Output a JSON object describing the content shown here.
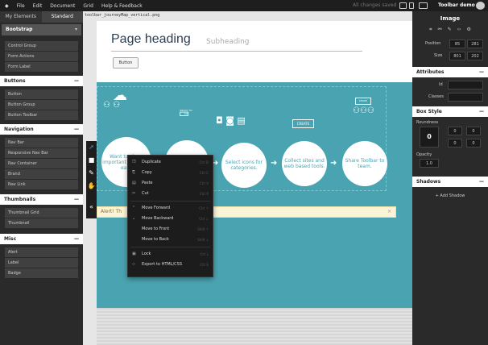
{
  "menu": {
    "items": [
      "File",
      "Edit",
      "Document",
      "Grid",
      "Help & Feedback"
    ],
    "status": "All changes saved",
    "app_name": "Toolbar demo"
  },
  "left_panel": {
    "tabs": [
      "My Elements",
      "Standard"
    ],
    "framework": "Bootstrap",
    "top_items": [
      "Control Group",
      "Form Actions",
      "Form Label"
    ],
    "sections": [
      {
        "title": "Buttons",
        "items": [
          "Button",
          "Button Group",
          "Button Toolbar"
        ]
      },
      {
        "title": "Navigation",
        "items": [
          "Nav Bar",
          "Responsive Nav Bar",
          "Nav Container",
          "Brand",
          "Nav Link"
        ]
      },
      {
        "title": "Thumbnails",
        "items": [
          "Thumbnail Grid",
          "Thumbnail"
        ]
      },
      {
        "title": "Misc",
        "items": [
          "Alert",
          "Label",
          "Badge"
        ]
      }
    ]
  },
  "canvas": {
    "file_name": "toolbar_journeyMap_vertical.png",
    "heading": "Page heading",
    "subheading": "Subheading",
    "button_label": "Button",
    "alert_text": "Alert! Th",
    "alert_close": "×",
    "journey": [
      "Want to share important with your easy",
      "",
      "Select icons for categories.",
      "Collect sites and web based tools.",
      "Share Toolbar to team."
    ],
    "badges": [
      "READY TO GO",
      "CREATE",
      "SHARE"
    ]
  },
  "context_menu": {
    "items": [
      {
        "icon": "duplicate-icon",
        "label": "Duplicate",
        "shortcut": "Ctrl D"
      },
      {
        "icon": "copy-icon",
        "label": "Copy",
        "shortcut": "Ctrl C"
      },
      {
        "icon": "paste-icon",
        "label": "Paste",
        "shortcut": "Ctrl V"
      },
      {
        "icon": "cut-icon",
        "label": "Cut",
        "shortcut": "Ctrl X"
      },
      {
        "icon": "move-forward-icon",
        "label": "Move Forward",
        "shortcut": "Ctrl ↑"
      },
      {
        "icon": "move-backward-icon",
        "label": "Move Backward",
        "shortcut": "Ctrl ↓"
      },
      {
        "icon": "",
        "label": "Move to Front",
        "shortcut": "Shift ↑"
      },
      {
        "icon": "",
        "label": "Move to Back",
        "shortcut": "Shift ↓"
      },
      {
        "icon": "lock-icon",
        "label": "Lock",
        "shortcut": "Ctrl L"
      },
      {
        "icon": "export-icon",
        "label": "Export to HTML/CSS",
        "shortcut": "Ctrl E"
      }
    ]
  },
  "right_panel": {
    "title": "Image",
    "position_label": "Position",
    "position_x": "85",
    "position_y": "281",
    "size_label": "Size",
    "size_w": "801",
    "size_h": "202",
    "attributes_title": "Attributes",
    "id_label": "Id",
    "classes_label": "Classes",
    "boxstyle_title": "Box Style",
    "roundness_label": "Roundness",
    "roundness_value": "0",
    "corners": [
      "0",
      "0",
      "0",
      "0"
    ],
    "opacity_label": "Opacity",
    "opacity_value": "1.0",
    "shadows_title": "Shadows",
    "add_shadow": "+ Add Shadow"
  }
}
